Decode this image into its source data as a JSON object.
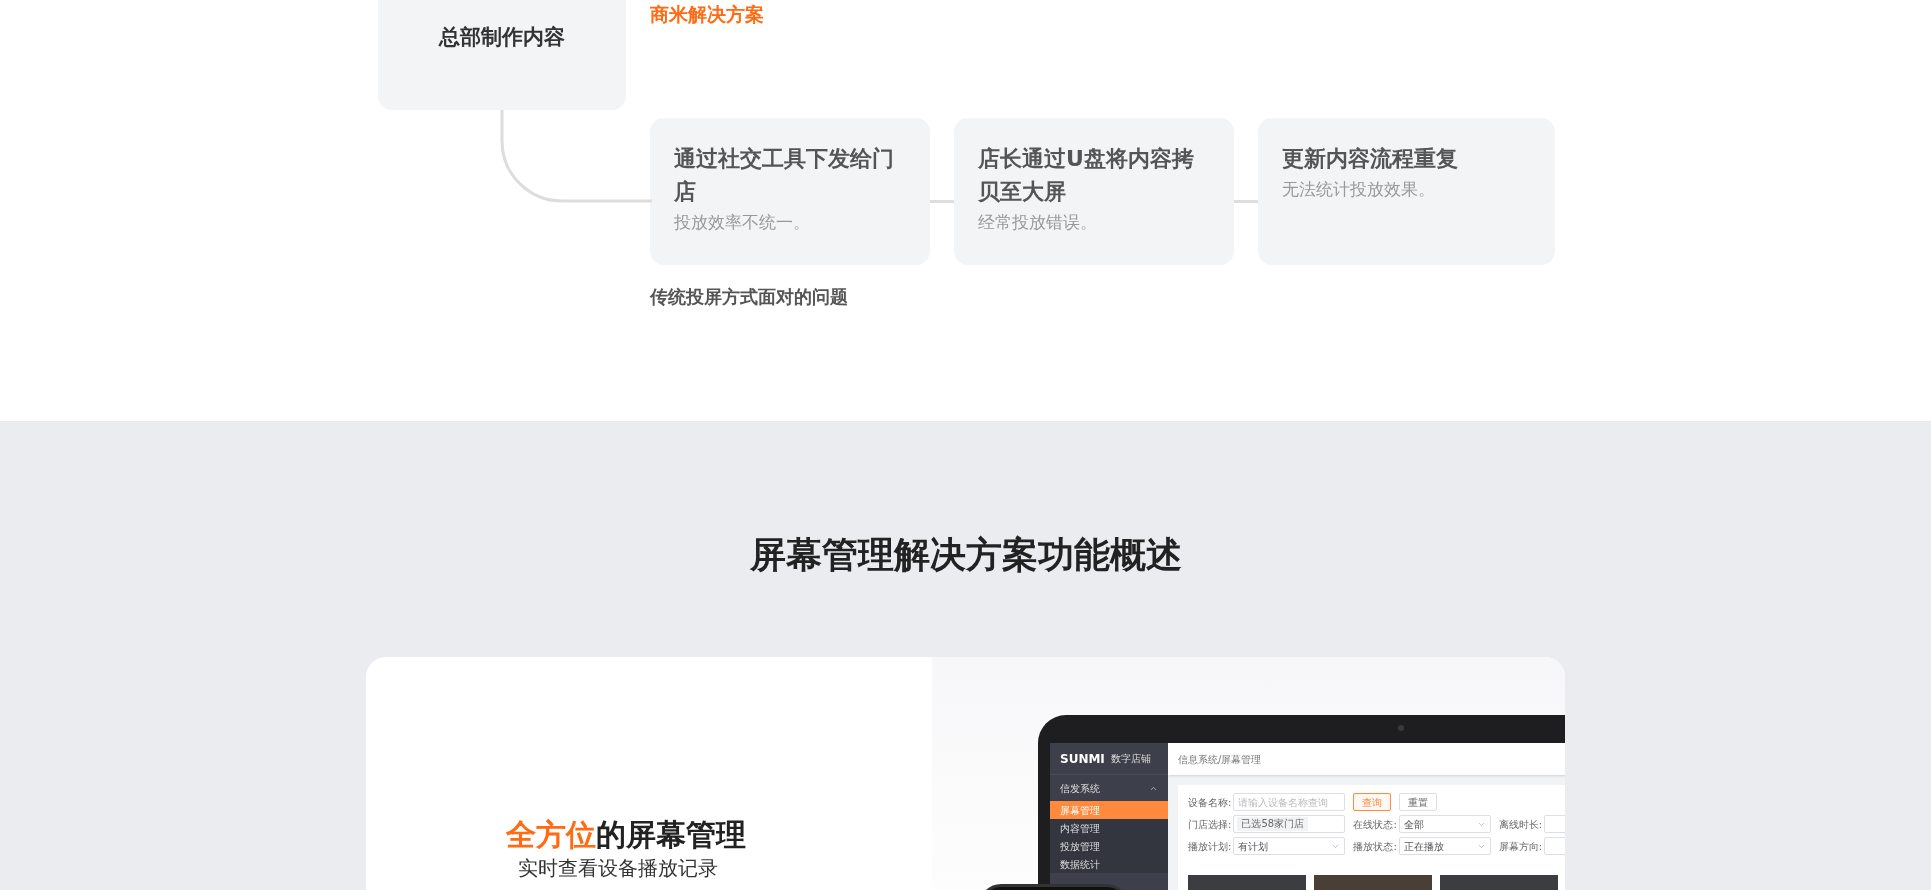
{
  "hq_box": {
    "title": "总部制作内容"
  },
  "solution_label": "商米解决方案",
  "problem_cards": [
    {
      "title": "通过社交工具下发给门店",
      "description": "投放效率不统一。"
    },
    {
      "title": "店长通过U盘将内容拷贝至大屏",
      "description": "经常投放错误。"
    },
    {
      "title": "更新内容流程重复",
      "description": "无法统计投放效果。"
    }
  ],
  "problems_caption": "传统投屏方式面对的问题",
  "overview": {
    "heading": "屏幕管理解决方案功能概述",
    "feature_title": {
      "highlight": "全方位",
      "rest": "的屏幕管理"
    },
    "feature_subtitle": "实时查看设备播放记录"
  },
  "app_screenshot": {
    "logo": "SUNMI",
    "logo_caption": "数字店铺",
    "breadcrumb": "信息系统/屏幕管理",
    "menu_group": {
      "label": "信发系统",
      "expanded": true
    },
    "menu_items": [
      {
        "label": "屏幕管理",
        "selected": true
      },
      {
        "label": "内容管理",
        "selected": false
      },
      {
        "label": "投放管理",
        "selected": false
      },
      {
        "label": "数据统计",
        "selected": false
      }
    ],
    "filter_rows": [
      {
        "fields": [
          {
            "label": "设备名称:",
            "kind": "input",
            "placeholder": "请输入设备名称查询"
          }
        ],
        "buttons": [
          {
            "label": "查询",
            "kind": "primary"
          },
          {
            "label": "重置",
            "kind": "default"
          }
        ]
      },
      {
        "fields": [
          {
            "label": "门店选择:",
            "kind": "tag",
            "value": "已选58家门店"
          },
          {
            "label": "在线状态:",
            "kind": "select",
            "value": "全部"
          },
          {
            "label": "离线时长:",
            "kind": "select"
          }
        ]
      },
      {
        "fields": [
          {
            "label": "播放计划:",
            "kind": "select",
            "value": "有计划"
          },
          {
            "label": "播放状态:",
            "kind": "select",
            "value": "正在播放"
          },
          {
            "label": "屏幕方向:",
            "kind": "select"
          }
        ]
      }
    ]
  }
}
